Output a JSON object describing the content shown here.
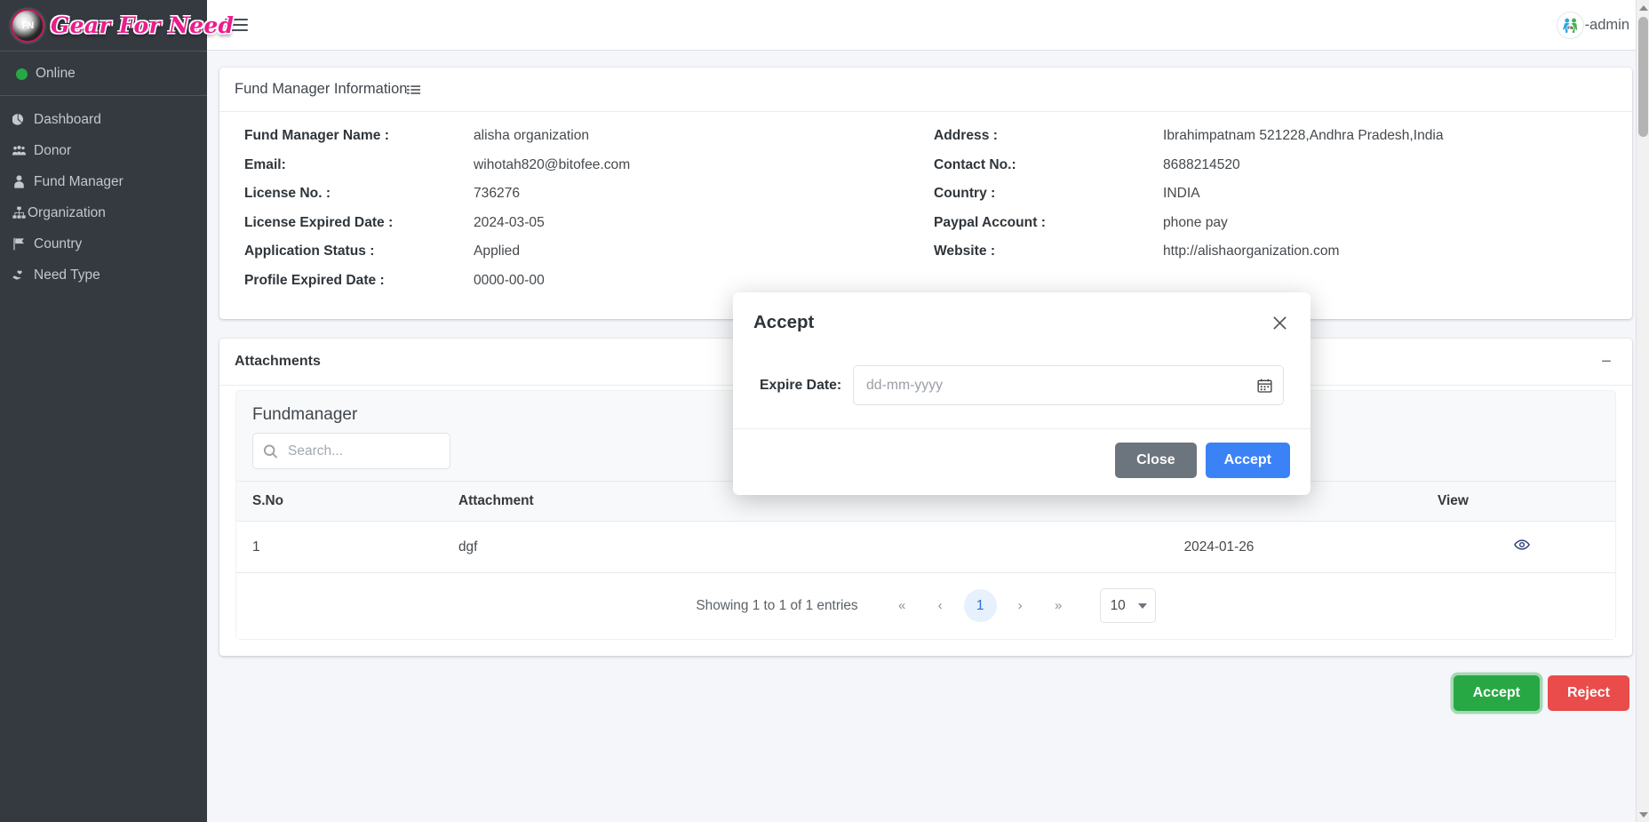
{
  "sidebar": {
    "brand": {
      "logo_text": "FN",
      "title": "Gear For Need"
    },
    "status": {
      "label": "Online"
    },
    "items": [
      {
        "label": "Dashboard",
        "icon": "pie-chart-icon"
      },
      {
        "label": "Donor",
        "icon": "users-icon"
      },
      {
        "label": "Fund Manager",
        "icon": "user-tie-icon"
      },
      {
        "label": "Organization",
        "icon": "sitemap-icon"
      },
      {
        "label": "Country",
        "icon": "flag-icon"
      },
      {
        "label": "Need Type",
        "icon": "hand-heart-icon"
      }
    ]
  },
  "topbar": {
    "menu_toggle": "hamburger-icon",
    "user_label": "-admin"
  },
  "fund_manager_card": {
    "title": "Fund Manager Information",
    "title_icon": "list-icon",
    "left_rows": [
      {
        "label": "Fund Manager Name :",
        "value": "alisha organization"
      },
      {
        "label": "Email:",
        "value": "wihotah820@bitofee.com"
      },
      {
        "label": "License No. :",
        "value": "736276"
      },
      {
        "label": "License Expired Date :",
        "value": "2024-03-05"
      },
      {
        "label": "Application Status :",
        "value": "Applied"
      },
      {
        "label": "Profile Expired Date :",
        "value": "0000-00-00"
      }
    ],
    "right_rows": [
      {
        "label": "Address :",
        "value": "Ibrahimpatnam 521228,Andhra Pradesh,India"
      },
      {
        "label": "Contact No.:",
        "value": "8688214520"
      },
      {
        "label": "Country :",
        "value": "INDIA"
      },
      {
        "label": "Paypal Account :",
        "value": "phone pay"
      },
      {
        "label": "Website :",
        "value": "http://alishaorganization.com"
      }
    ]
  },
  "attachments_card": {
    "title": "Attachments",
    "minimize_label": "−",
    "panel_title": "Fundmanager",
    "search": {
      "placeholder": "Search...",
      "value": "",
      "icon": "search-icon"
    },
    "table": {
      "columns": [
        "S.No",
        "Attachment",
        "",
        "View"
      ],
      "rows": [
        {
          "sno": "1",
          "attachment": "dgf",
          "date": "2024-01-26",
          "view_icon": "eye-icon"
        }
      ]
    },
    "pagination": {
      "info": "Showing 1 to 1 of 1 entries",
      "first": "«",
      "prev": "‹",
      "current_page": "1",
      "next": "›",
      "last": "»",
      "per_page": "10"
    }
  },
  "footer_actions": {
    "accept_label": "Accept",
    "reject_label": "Reject",
    "accept_color": "#28a745",
    "reject_color": "#ea4b4b"
  },
  "modal": {
    "title": "Accept",
    "close_icon": "close-icon",
    "field_label": "Expire Date:",
    "date": {
      "placeholder": "dd-mm-yyyy",
      "value": "",
      "icon": "calendar-icon"
    },
    "close_label": "Close",
    "accept_label": "Accept",
    "accept_color": "#3b82f6",
    "close_color": "#6c757d"
  }
}
